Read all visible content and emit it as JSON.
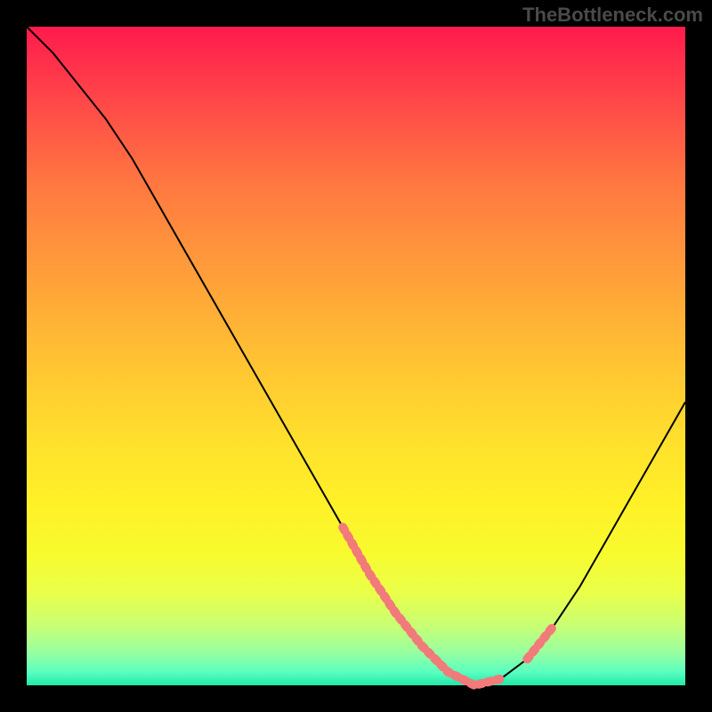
{
  "watermark": "TheBottleneck.com",
  "chart_data": {
    "type": "line",
    "title": "",
    "xlabel": "",
    "ylabel": "",
    "xlim": [
      0,
      100
    ],
    "ylim": [
      0,
      100
    ],
    "grid": false,
    "curve": {
      "name": "bottleneck-curve",
      "color": "#000000",
      "x": [
        0,
        4,
        8,
        12,
        16,
        20,
        24,
        28,
        32,
        36,
        40,
        44,
        48,
        52,
        56,
        60,
        64,
        68,
        72,
        76,
        80,
        84,
        88,
        92,
        96,
        100
      ],
      "y": [
        100,
        96,
        91,
        86,
        80,
        73,
        66,
        59,
        52,
        45,
        38,
        31,
        24,
        17,
        11,
        6,
        2,
        0,
        1,
        4,
        9,
        15,
        22,
        29,
        36,
        43
      ]
    },
    "highlight_segments": [
      {
        "name": "left-shoulder",
        "color": "#f27a7a",
        "x": [
          48,
          52,
          56,
          60
        ],
        "y": [
          24,
          17,
          11,
          6
        ]
      },
      {
        "name": "valley-floor",
        "color": "#f27a7a",
        "x": [
          60,
          64,
          68,
          72
        ],
        "y": [
          6,
          2,
          0,
          1
        ]
      },
      {
        "name": "right-shoulder",
        "color": "#f27a7a",
        "x": [
          76,
          80
        ],
        "y": [
          4,
          9
        ]
      }
    ],
    "gradient_stops": [
      {
        "pos": 0,
        "color": "#ff1a4d"
      },
      {
        "pos": 50,
        "color": "#ffc832"
      },
      {
        "pos": 85,
        "color": "#f0ff40"
      },
      {
        "pos": 100,
        "color": "#20e8a8"
      }
    ]
  }
}
